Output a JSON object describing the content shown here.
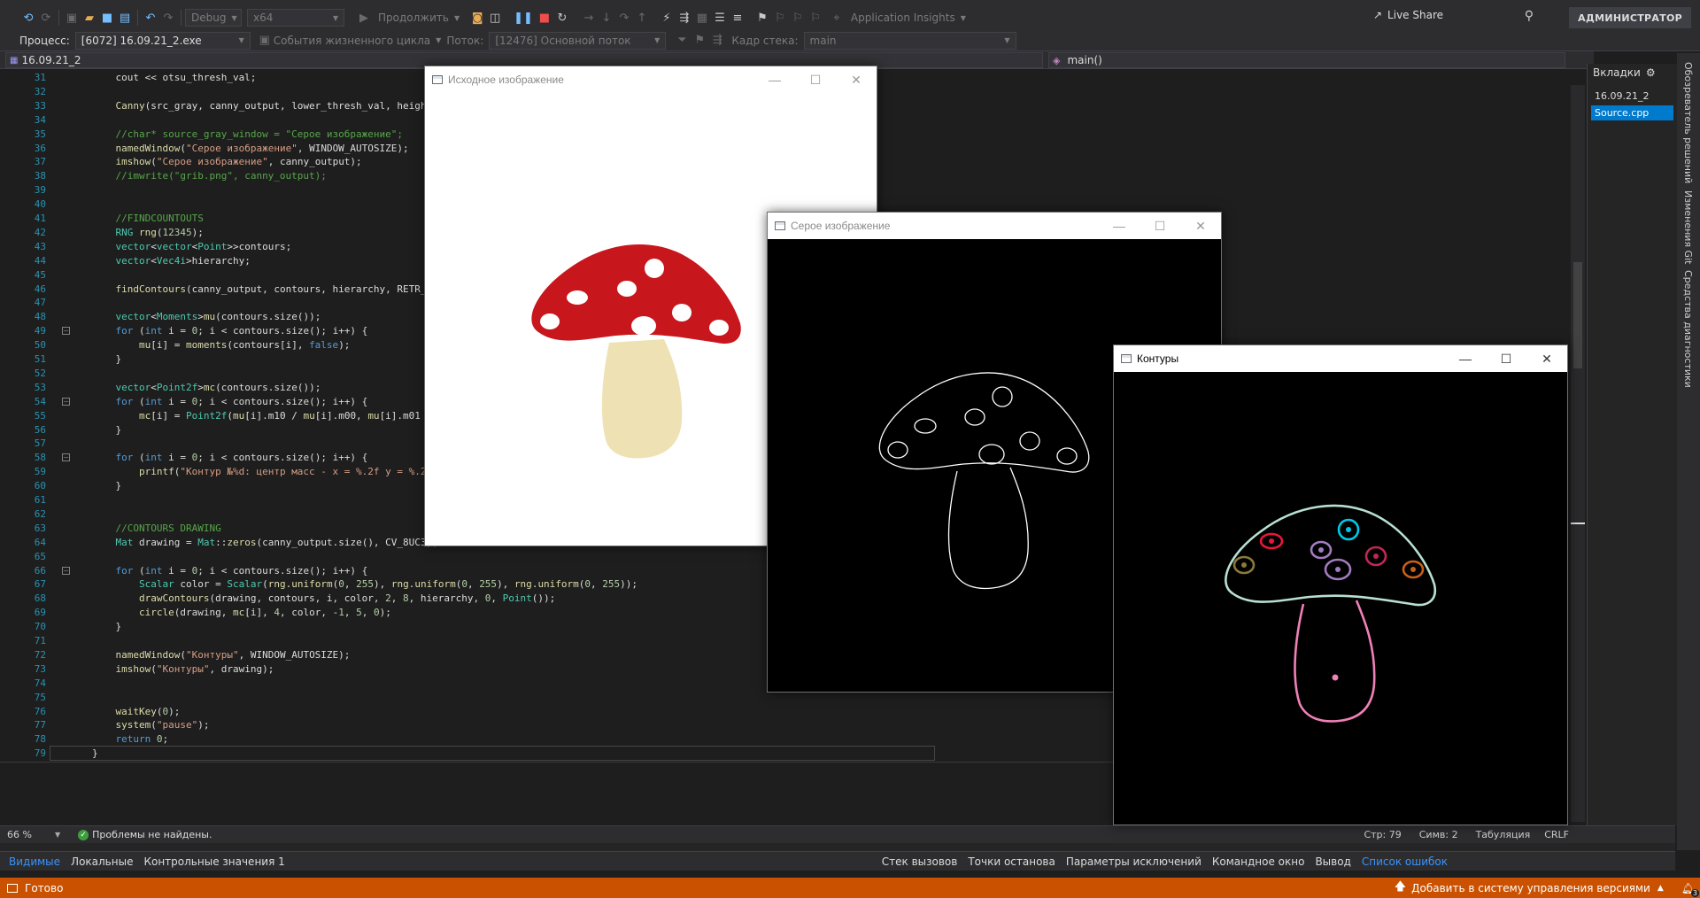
{
  "toolbar": {
    "config": "Debug",
    "platform": "x64",
    "continue_label": "Продолжить",
    "app_insights": "Application Insights",
    "live_share": "Live Share",
    "user": "АДМИНИСТРАТОР"
  },
  "debugbar": {
    "process_label": "Процесс:",
    "process_value": "[6072] 16.09.21_2.exe",
    "lifecycle": "События жизненного цикла",
    "thread_label": "Поток:",
    "thread_value": "[12476] Основной поток",
    "frame_label": "Кадр стека:",
    "frame_value": "main"
  },
  "editor": {
    "project_combo": "16.09.21_2",
    "function_combo": "main()"
  },
  "tabs_panel": {
    "title": "Вкладки",
    "items": [
      "16.09.21_2",
      "Source.cpp"
    ]
  },
  "side_rail": [
    "Обозреватель решений",
    "Изменения Git",
    "Средства диагностики"
  ],
  "code_lines": [
    {
      "n": "31",
      "t": "    cout << otsu_thresh_val;"
    },
    {
      "n": "32",
      "t": ""
    },
    {
      "n": "33",
      "t": "    Canny(src_gray, canny_output, lower_thresh_val, height"
    },
    {
      "n": "34",
      "t": ""
    },
    {
      "n": "35",
      "t": "    //char* source_gray_window = \"Серое изображение\";"
    },
    {
      "n": "36",
      "t": "    namedWindow(\"Серое изображение\", WINDOW_AUTOSIZE);"
    },
    {
      "n": "37",
      "t": "    imshow(\"Серое изображение\", canny_output);"
    },
    {
      "n": "38",
      "t": "    //imwrite(\"grib.png\", canny_output);"
    },
    {
      "n": "39",
      "t": ""
    },
    {
      "n": "40",
      "t": ""
    },
    {
      "n": "41",
      "t": "    //FINDCOUNTOUTS"
    },
    {
      "n": "42",
      "t": "    RNG rng(12345);"
    },
    {
      "n": "43",
      "t": "    vector<vector<Point>>contours;"
    },
    {
      "n": "44",
      "t": "    vector<Vec4i>hierarchy;"
    },
    {
      "n": "45",
      "t": ""
    },
    {
      "n": "46",
      "t": "    findContours(canny_output, contours, hierarchy, RETR_T"
    },
    {
      "n": "47",
      "t": ""
    },
    {
      "n": "48",
      "t": "    vector<Moments>mu(contours.size());"
    },
    {
      "n": "49",
      "t": "    for (int i = 0; i < contours.size(); i++) {"
    },
    {
      "n": "50",
      "t": "        mu[i] = moments(contours[i], false);"
    },
    {
      "n": "51",
      "t": "    }"
    },
    {
      "n": "52",
      "t": ""
    },
    {
      "n": "53",
      "t": "    vector<Point2f>mc(contours.size());"
    },
    {
      "n": "54",
      "t": "    for (int i = 0; i < contours.size(); i++) {"
    },
    {
      "n": "55",
      "t": "        mc[i] = Point2f(mu[i].m10 / mu[i].m00, mu[i].m01 /"
    },
    {
      "n": "56",
      "t": "    }"
    },
    {
      "n": "57",
      "t": ""
    },
    {
      "n": "58",
      "t": "    for (int i = 0; i < contours.size(); i++) {"
    },
    {
      "n": "59",
      "t": "        printf(\"Контур №%d: центр масс - x = %.2f y = %.2f"
    },
    {
      "n": "60",
      "t": "    }"
    },
    {
      "n": "61",
      "t": ""
    },
    {
      "n": "62",
      "t": ""
    },
    {
      "n": "63",
      "t": "    //CONTOURS DRAWING"
    },
    {
      "n": "64",
      "t": "    Mat drawing = Mat::zeros(canny_output.size(), CV_8UC3);"
    },
    {
      "n": "65",
      "t": ""
    },
    {
      "n": "66",
      "t": "    for (int i = 0; i < contours.size(); i++) {"
    },
    {
      "n": "67",
      "t": "        Scalar color = Scalar(rng.uniform(0, 255), rng.uniform(0, 255), rng.uniform(0, 255));"
    },
    {
      "n": "68",
      "t": "        drawContours(drawing, contours, i, color, 2, 8, hierarchy, 0, Point());"
    },
    {
      "n": "69",
      "t": "        circle(drawing, mc[i], 4, color, -1, 5, 0);"
    },
    {
      "n": "70",
      "t": "    }"
    },
    {
      "n": "71",
      "t": ""
    },
    {
      "n": "72",
      "t": "    namedWindow(\"Контуры\", WINDOW_AUTOSIZE);"
    },
    {
      "n": "73",
      "t": "    imshow(\"Контуры\", drawing);"
    },
    {
      "n": "74",
      "t": ""
    },
    {
      "n": "75",
      "t": ""
    },
    {
      "n": "76",
      "t": "    waitKey(0);"
    },
    {
      "n": "77",
      "t": "    system(\"pause\");"
    },
    {
      "n": "78",
      "t": "    return 0;"
    },
    {
      "n": "79",
      "t": "}"
    }
  ],
  "windows": {
    "source": {
      "title": "Исходное изображение"
    },
    "gray": {
      "title": "Серое изображение"
    },
    "contours": {
      "title": "Контуры"
    }
  },
  "status_strip": {
    "zoom": "66 %",
    "problems": "Проблемы не найдены.",
    "line": "Стр: 79",
    "char": "Симв: 2",
    "tabs": "Табуляция",
    "eol": "CRLF"
  },
  "bottom_tabs_left": [
    "Видимые",
    "Локальные",
    "Контрольные значения 1"
  ],
  "bottom_tabs_right": [
    "Стек вызовов",
    "Точки останова",
    "Параметры исключений",
    "Командное окно",
    "Вывод",
    "Список ошибок"
  ],
  "statusbar": {
    "ready": "Готово",
    "source_control": "Добавить в систему управления версиями",
    "notif_count": "3"
  },
  "colors": {
    "accent": "#007acc",
    "statusbar": "#ca5100",
    "mushroom_cap": "#c8161d",
    "mushroom_stem": "#eee2b5"
  }
}
